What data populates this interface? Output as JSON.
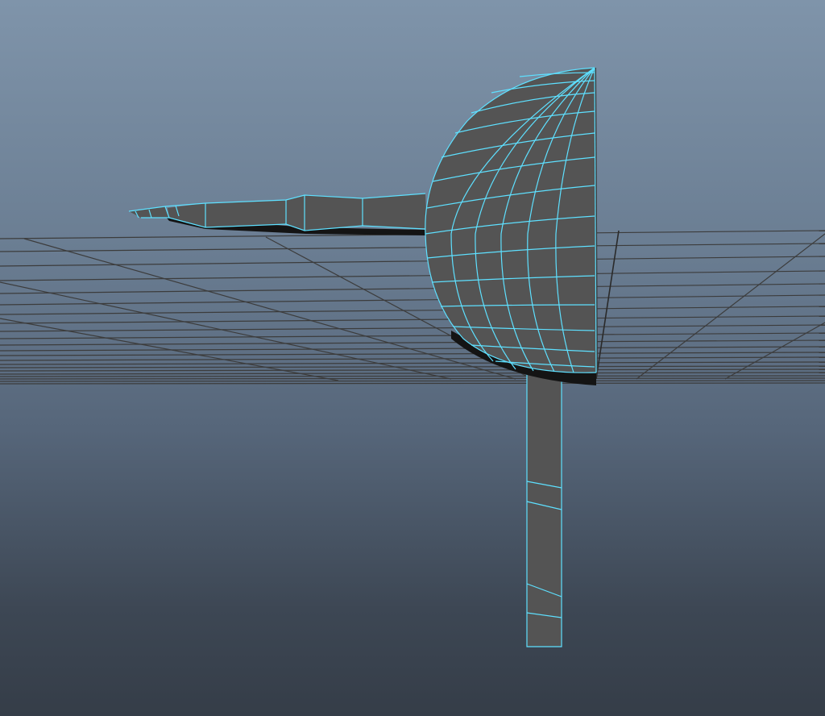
{
  "viewport": {
    "background_top": "#7f94aa",
    "background_bottom": "#353d48",
    "grid_color": "#3c3c3c",
    "mesh_color": "#545454",
    "wireframe_color": "#5ee0ff"
  },
  "scene": {
    "objects": [
      {
        "name": "hemisphere",
        "selected": true
      },
      {
        "name": "vertical-cylinder",
        "selected": true
      },
      {
        "name": "horizontal-arm",
        "selected": true
      }
    ]
  }
}
